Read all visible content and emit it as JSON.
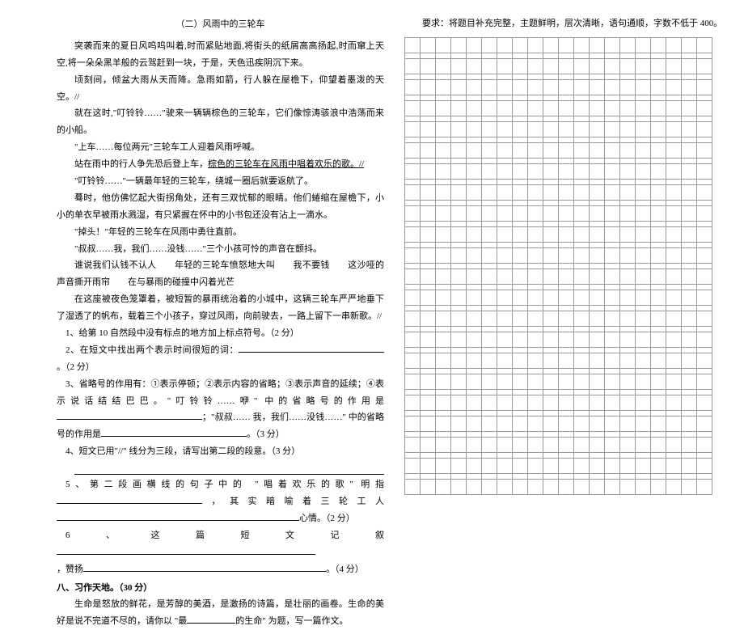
{
  "reading": {
    "heading": "（二）风雨中的三轮车",
    "p1": "突袭而来的夏日风呜呜叫着,时而紧贴地面,将街头的纸屑高高扬起,时而窜上天空,将一朵朵黑羊般的云驾赶到一块，于是，天色迅疾阴沉下来。",
    "p2": "顷刻间，倾盆大雨从天而降。急雨如箭，行人躲在屋檐下，仰望着墨泼的天空。//",
    "p3": "就在这时,\"叮铃铃……\"驶来一辆辆棕色的三轮车，它们像惊涛骇浪中浩荡而来的小船。",
    "p4": "\"上车……每位两元\"三轮车工人迎着风雨呼喊。",
    "p5_plain": "站在雨中的行人争先恐后登上车，",
    "p5_underline": "棕色的三轮车在风雨中唱着欢乐的歌。//",
    "p6": "\"叮铃铃……\"一辆最年轻的三轮车，绕城一圈后就要返航了。",
    "p7": "蓦时，他仿佛忆起大街拐角处，还有三双忧郁的眼睛。他们蜷缩在屋檐下，小小的单衣早被雨水溅湿，有只紧握在怀中的小书包还没有沾上一滴水。",
    "p8": "\"掉头！\"年轻的三轮车在风雨中勇往直前。",
    "p9": "\"叔叔……我，我们……没钱……\"三个小孩可怜的声音在颤抖。",
    "p10": "谁说我们认钱不认人　　年轻的三轮车愤怒地大叫　　我不要钱　　这沙哑的声音撕开雨帘　　在与暴雨的碰撞中闪着光芒",
    "p11": "在这座被夜色笼罩着，被短暂的暴雨统治着的小城中，这辆三轮车严严地垂下了湿透了的帆布，载着三个小孩子，穿过风雨，向前驶去，一路上留下一串新歌。//"
  },
  "questions": {
    "q1": "1、给第 10 自然段中没有标点的地方加上标点符号。（2 分）",
    "q2_a": "2、在短文中找出两个表示时间很短的词：",
    "q2_b": "。（2 分）",
    "q3_a": "3、省略号的作用有：①表示停顿；②表示内容的省略；③表示声音的延续；④表示说话结结巴巴。\"叮铃铃……咿\" 中的省略号的作用是",
    "q3_b": "；\"叔叔…… 我，我们……没钱……\" 中的省略号的作用是",
    "q3_c": "。（3 分）",
    "q4_a": "4、短文已用\"//\" 线分为三段，请写出第二段的段意。（3 分）",
    "q5_a": "5、第二段画横线的句子中的 \"唱着欢乐的歌\" 明指",
    "q5_b": "，其实暗喻着三轮工人",
    "q5_c": "心情。（2 分）",
    "q6_a": "6、这篇短文记叙",
    "q6_b": "，赞扬",
    "q6_c": "。（4 分）"
  },
  "composition": {
    "heading": "八、习作天地。（30 分）",
    "prompt_a": "生命是怒放的鲜花，是芳醇的美酒，是激扬的诗篇，是壮丽的画卷。生命的美好是说不完道不尽的，请你以 \"最",
    "prompt_b": "的生命\" 为题，写一篇作文。",
    "requirement": "要求：将题目补充完整，主题鲜明，层次清晰，语句通顺，字数不低于 400。"
  }
}
